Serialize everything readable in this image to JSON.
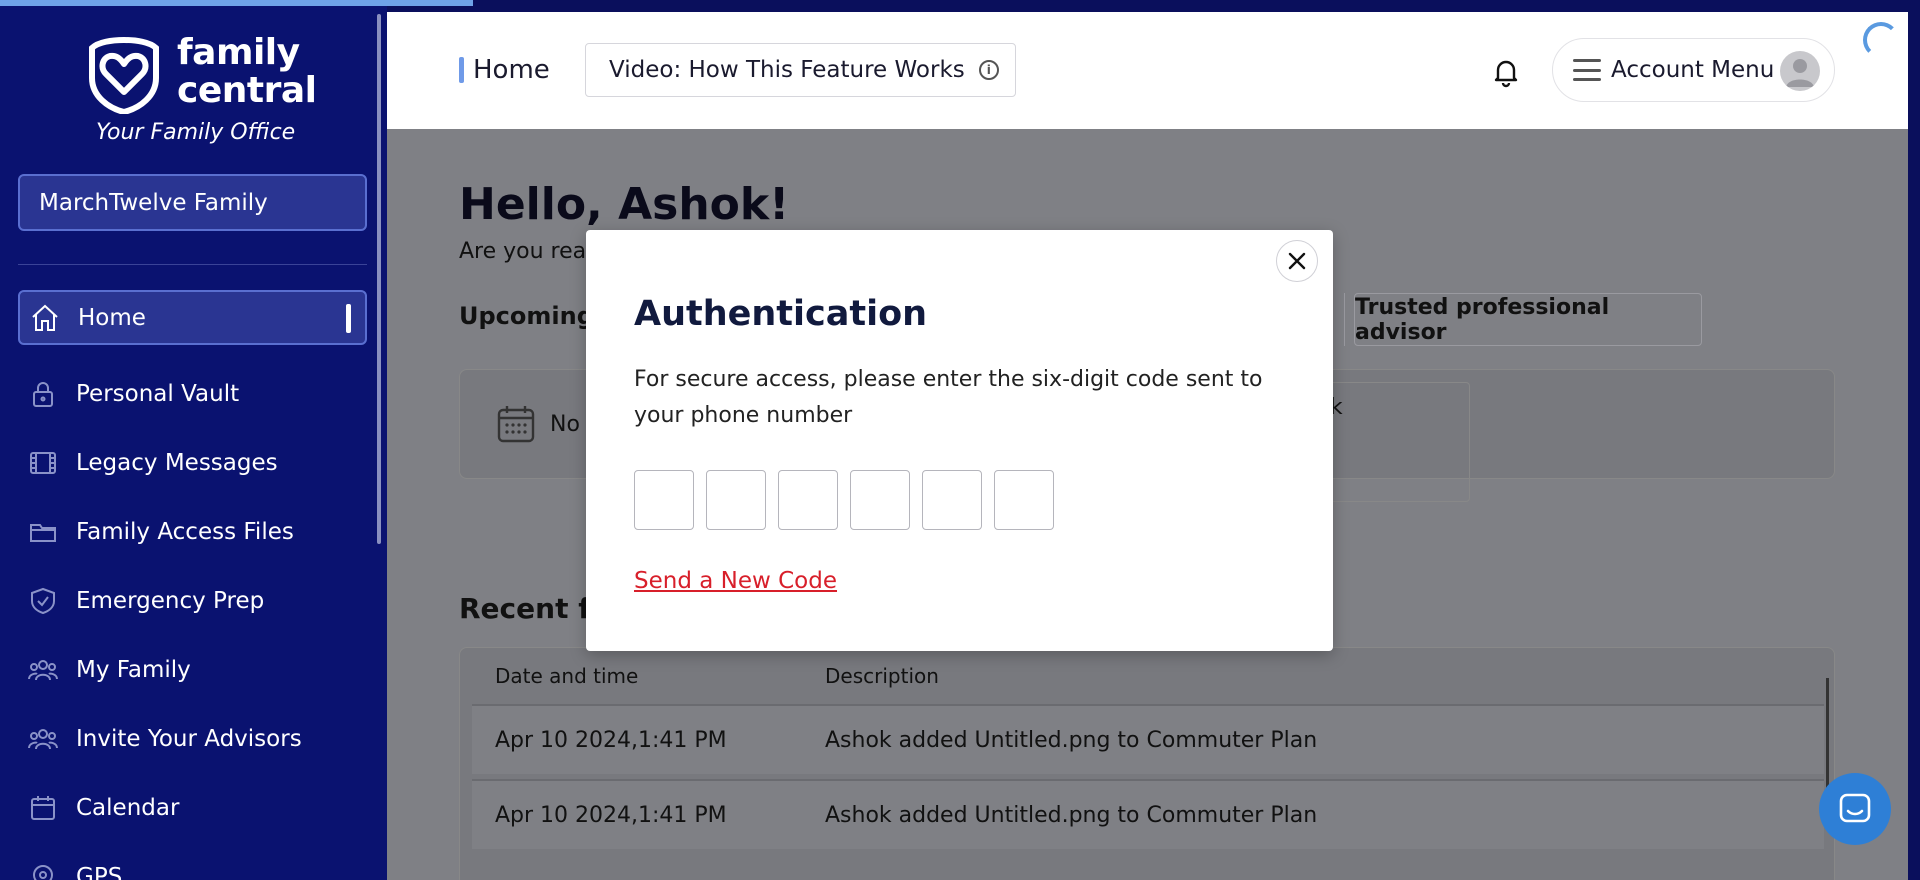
{
  "brand": {
    "logo_word_1": "family",
    "logo_word_2": "central",
    "tagline": "Your Family Office"
  },
  "sidebar": {
    "family_selector": "MarchTwelve Family",
    "items": [
      {
        "label": "Home",
        "icon": "home-icon",
        "active": true
      },
      {
        "label": "Personal Vault",
        "icon": "lock-icon"
      },
      {
        "label": "Legacy Messages",
        "icon": "film-icon"
      },
      {
        "label": "Family Access Files",
        "icon": "folder-icon"
      },
      {
        "label": "Emergency Prep",
        "icon": "shield-icon"
      },
      {
        "label": "My Family",
        "icon": "people-icon"
      },
      {
        "label": "Invite Your Advisors",
        "icon": "people-icon"
      },
      {
        "label": "Calendar",
        "icon": "calendar-icon"
      },
      {
        "label": "GPS",
        "icon": "location-icon"
      }
    ]
  },
  "header": {
    "breadcrumb": "Home",
    "video_button": "Video: How This Feature Works",
    "account_menu": "Account Menu"
  },
  "main": {
    "greeting": "Hello, Ashok!",
    "subgreeting": "Are you rea",
    "upcoming_label": "Upcoming",
    "advisor_tab": "Trusted professional advisor",
    "events_no": "No",
    "events_inner_text": "shok",
    "recent_label": "Recent fa",
    "table": {
      "columns": [
        "Date and time",
        "Description"
      ],
      "rows": [
        [
          "Apr 10 2024,1:41 PM",
          "Ashok added Untitled.png to Commuter Plan"
        ],
        [
          "Apr 10 2024,1:41 PM",
          "Ashok added Untitled.png to Commuter Plan"
        ]
      ]
    }
  },
  "modal": {
    "title": "Authentication",
    "message": "For secure access, please enter the six-digit code sent to your phone number",
    "code_digits": 6,
    "resend_link": "Send a New Code"
  },
  "colors": {
    "sidebar_bg": "#0a1270",
    "accent": "#6f9ae8",
    "link_red": "#d81f2a",
    "chat_blue": "#2e7fd6"
  }
}
